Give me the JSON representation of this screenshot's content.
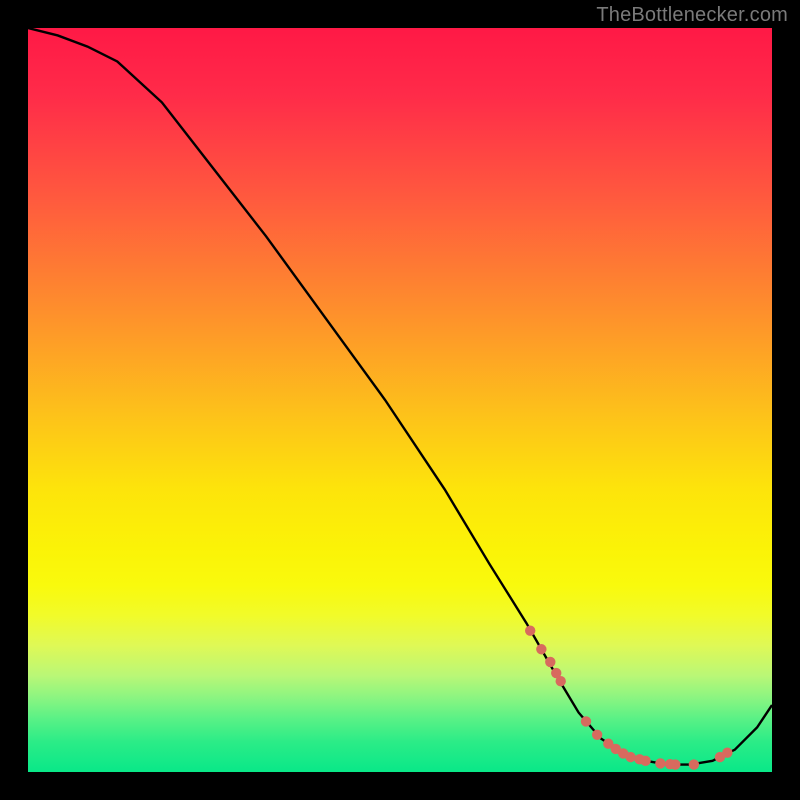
{
  "attribution": "TheBottlenecker.com",
  "chart_data": {
    "type": "line",
    "title": "",
    "xlabel": "",
    "ylabel": "",
    "xlim": [
      0,
      100
    ],
    "ylim": [
      0,
      100
    ],
    "series": [
      {
        "name": "bottleneck-curve",
        "x": [
          0,
          4,
          8,
          12,
          18,
          25,
          32,
          40,
          48,
          56,
          62,
          67,
          71,
          74,
          77,
          80,
          83,
          86,
          89,
          92,
          95,
          98,
          100
        ],
        "y": [
          100,
          99,
          97.5,
          95.5,
          90,
          81,
          72,
          61,
          50,
          38,
          28,
          20,
          13,
          8,
          4.5,
          2.5,
          1.5,
          1,
          1,
          1.5,
          3,
          6,
          9
        ]
      }
    ],
    "markers": {
      "name": "highlight-points",
      "x": [
        67.5,
        69,
        70.2,
        71,
        71.6,
        75,
        76.5,
        78,
        79,
        80,
        81,
        82.2,
        83,
        85,
        86.3,
        87,
        89.5,
        93,
        94
      ],
      "y": [
        19,
        16.5,
        14.8,
        13.3,
        12.2,
        6.8,
        5,
        3.8,
        3.1,
        2.5,
        2.0,
        1.7,
        1.5,
        1.15,
        1.05,
        1.0,
        1.0,
        2.0,
        2.6
      ]
    }
  }
}
